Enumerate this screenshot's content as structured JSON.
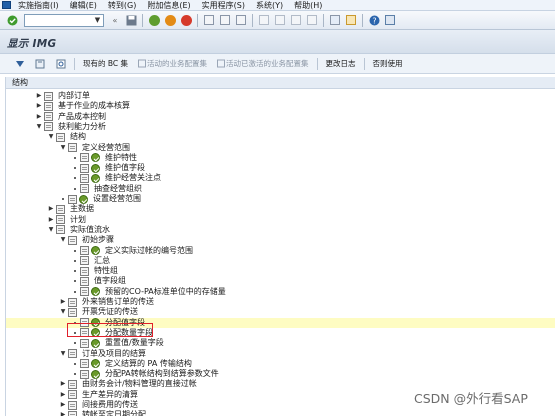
{
  "menubar": {
    "items": [
      "实施指南(I)",
      "编辑(E)",
      "转到(G)",
      "附加信息(E)",
      "实用程序(S)",
      "系统(Y)",
      "帮助(H)"
    ]
  },
  "toolbar": {
    "command_field_value": "",
    "icons": [
      "enter-icon",
      "save-icon",
      "back-icon",
      "exit-icon",
      "cancel-icon",
      "print-icon",
      "find-icon",
      "find-next-icon",
      "first-page-icon",
      "prev-page-icon",
      "next-page-icon",
      "last-page-icon",
      "new-session-icon",
      "shortcut-icon",
      "help-icon",
      "layout-icon"
    ]
  },
  "title": "显示 IMG",
  "apptoolbar": {
    "buttons": [
      {
        "label": "",
        "icon": "expand-icon",
        "enabled": true
      },
      {
        "label": "",
        "icon": "collapse-icon",
        "enabled": true
      },
      {
        "label": "",
        "icon": "search-icon",
        "enabled": true
      },
      {
        "label": "现有的 BC 集",
        "enabled": true
      },
      {
        "label": "活动的业务配置集",
        "enabled": false
      },
      {
        "label": "活动已激活的业务配置集",
        "enabled": false
      },
      {
        "label": "更改日志",
        "enabled": true
      },
      {
        "label": "否则使用",
        "enabled": true
      }
    ]
  },
  "tree": {
    "header": "结构",
    "rows": [
      {
        "label": "内部订单",
        "level": 2,
        "state": "collapsed",
        "icons": [
          "doc"
        ]
      },
      {
        "label": "基于作业的成本核算",
        "level": 2,
        "state": "collapsed",
        "icons": [
          "doc"
        ]
      },
      {
        "label": "产品成本控制",
        "level": 2,
        "state": "collapsed",
        "icons": [
          "doc"
        ]
      },
      {
        "label": "获利能力分析",
        "level": 2,
        "state": "expanded",
        "icons": [
          "doc"
        ]
      },
      {
        "label": "结构",
        "level": 3,
        "state": "expanded",
        "icons": [
          "doc"
        ]
      },
      {
        "label": "定义经营范围",
        "level": 4,
        "state": "expanded",
        "icons": [
          "doc"
        ]
      },
      {
        "label": "维护特性",
        "level": 5,
        "state": "leaf",
        "icons": [
          "doc",
          "activity"
        ]
      },
      {
        "label": "维护值字段",
        "level": 5,
        "state": "leaf",
        "icons": [
          "doc",
          "activity"
        ]
      },
      {
        "label": "维护经营关注点",
        "level": 5,
        "state": "leaf",
        "icons": [
          "doc",
          "activity"
        ]
      },
      {
        "label": "抽查经营组织",
        "level": 5,
        "state": "leaf",
        "icons": [
          "doc"
        ]
      },
      {
        "label": "设置经营范围",
        "level": 4,
        "state": "leaf",
        "icons": [
          "doc",
          "activity"
        ]
      },
      {
        "label": "主数据",
        "level": 3,
        "state": "collapsed",
        "icons": [
          "doc"
        ]
      },
      {
        "label": "计划",
        "level": 3,
        "state": "collapsed",
        "icons": [
          "doc"
        ]
      },
      {
        "label": "实际值流水",
        "level": 3,
        "state": "expanded",
        "icons": [
          "doc"
        ]
      },
      {
        "label": "初始步骤",
        "level": 4,
        "state": "expanded",
        "icons": [
          "doc"
        ]
      },
      {
        "label": "定义实际过帐的编号范围",
        "level": 5,
        "state": "leaf",
        "icons": [
          "doc",
          "activity"
        ]
      },
      {
        "label": "汇总",
        "level": 5,
        "state": "leaf",
        "icons": [
          "doc"
        ]
      },
      {
        "label": "特性组",
        "level": 5,
        "state": "leaf",
        "icons": [
          "doc"
        ]
      },
      {
        "label": "值字段组",
        "level": 5,
        "state": "leaf",
        "icons": [
          "doc"
        ]
      },
      {
        "label": "预留的CO-PA标准单位中的存储量",
        "level": 5,
        "state": "leaf",
        "icons": [
          "doc",
          "activity"
        ]
      },
      {
        "label": "外来销售订单的传送",
        "level": 4,
        "state": "collapsed",
        "icons": [
          "doc"
        ]
      },
      {
        "label": "开票凭证的传送",
        "level": 4,
        "state": "expanded",
        "icons": [
          "doc"
        ]
      },
      {
        "label": "分配值字段",
        "level": 5,
        "state": "leaf",
        "icons": [
          "doc",
          "activity"
        ],
        "highlight": true
      },
      {
        "label": "分配数量字段",
        "level": 5,
        "state": "leaf",
        "icons": [
          "doc",
          "activity"
        ],
        "boxed": true
      },
      {
        "label": "重置值/数量字段",
        "level": 5,
        "state": "leaf",
        "icons": [
          "doc",
          "activity"
        ]
      },
      {
        "label": "订单及项目的结算",
        "level": 4,
        "state": "expanded",
        "icons": [
          "doc"
        ]
      },
      {
        "label": "定义结算的 PA 传输结构",
        "level": 5,
        "state": "leaf",
        "icons": [
          "doc",
          "activity"
        ]
      },
      {
        "label": "分配PA转帐结构到结算参数文件",
        "level": 5,
        "state": "leaf",
        "icons": [
          "doc",
          "activity"
        ]
      },
      {
        "label": "由财务会计/物料管理的直接过帐",
        "level": 4,
        "state": "collapsed",
        "icons": [
          "doc"
        ]
      },
      {
        "label": "生产差异的清算",
        "level": 4,
        "state": "collapsed",
        "icons": [
          "doc"
        ]
      },
      {
        "label": "间接费用的传送",
        "level": 4,
        "state": "collapsed",
        "icons": [
          "doc"
        ]
      },
      {
        "label": "转帐至定日期分配",
        "level": 4,
        "state": "collapsed",
        "icons": [
          "doc"
        ]
      }
    ]
  },
  "watermark": "CSDN @外行看SAP"
}
